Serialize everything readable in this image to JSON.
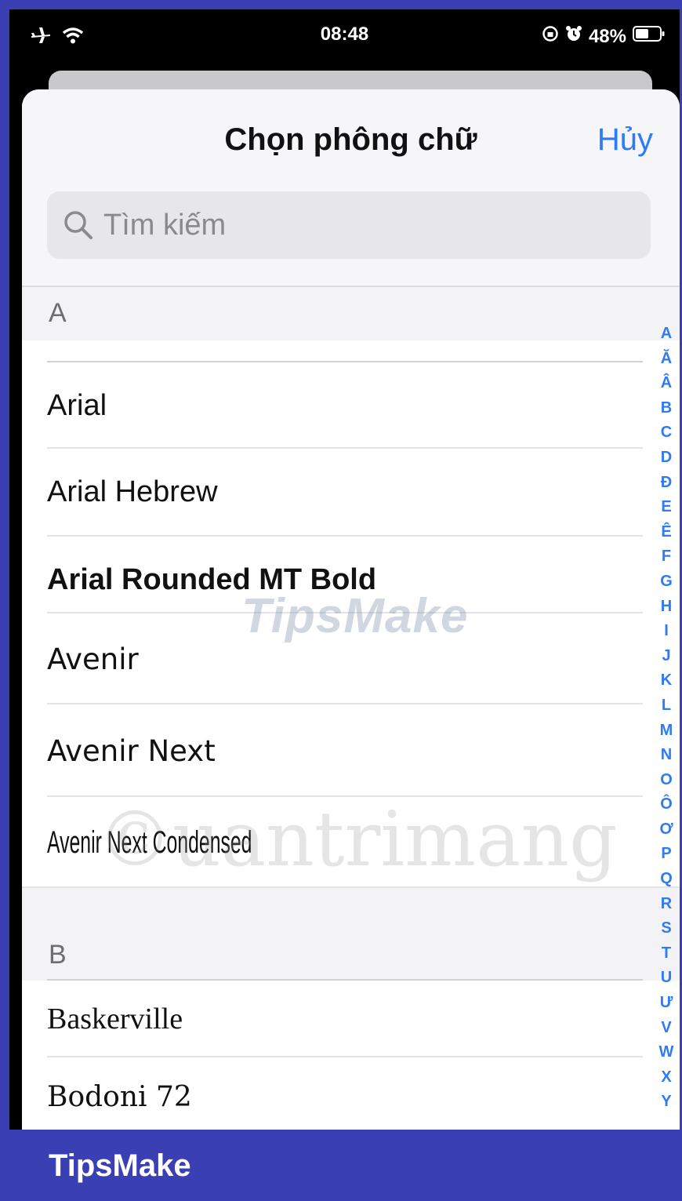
{
  "status_bar": {
    "time": "08:48",
    "battery": "48%",
    "icons": [
      "airplane-icon",
      "wifi-icon",
      "rotation-lock-icon",
      "alarm-icon",
      "battery-icon"
    ]
  },
  "sheet": {
    "title": "Chọn phông chữ",
    "cancel_label": "Hủy",
    "search_placeholder": "Tìm kiếm"
  },
  "sections": [
    {
      "header": "A",
      "fonts": [
        "Arial",
        "Arial Hebrew",
        "Arial Rounded MT Bold",
        "Avenir",
        "Avenir Next",
        "Avenir Next Condensed"
      ]
    },
    {
      "header": "B",
      "fonts": [
        "Baskerville",
        "Bodoni 72"
      ]
    }
  ],
  "index_letters": [
    "A",
    "Ă",
    "Â",
    "B",
    "C",
    "D",
    "Đ",
    "E",
    "Ê",
    "F",
    "G",
    "H",
    "I",
    "J",
    "K",
    "L",
    "M",
    "N",
    "O",
    "Ô",
    "Ơ",
    "P",
    "Q",
    "R",
    "S",
    "T",
    "U",
    "Ư",
    "V",
    "W",
    "X",
    "Y"
  ],
  "watermarks": [
    "TipsMake",
    "©uantrimang"
  ],
  "footer_brand": "TipsMake",
  "colors": {
    "accent": "#2f7bf5",
    "frame": "#3a3fb3",
    "sheet_header": "#f6f6f8"
  }
}
